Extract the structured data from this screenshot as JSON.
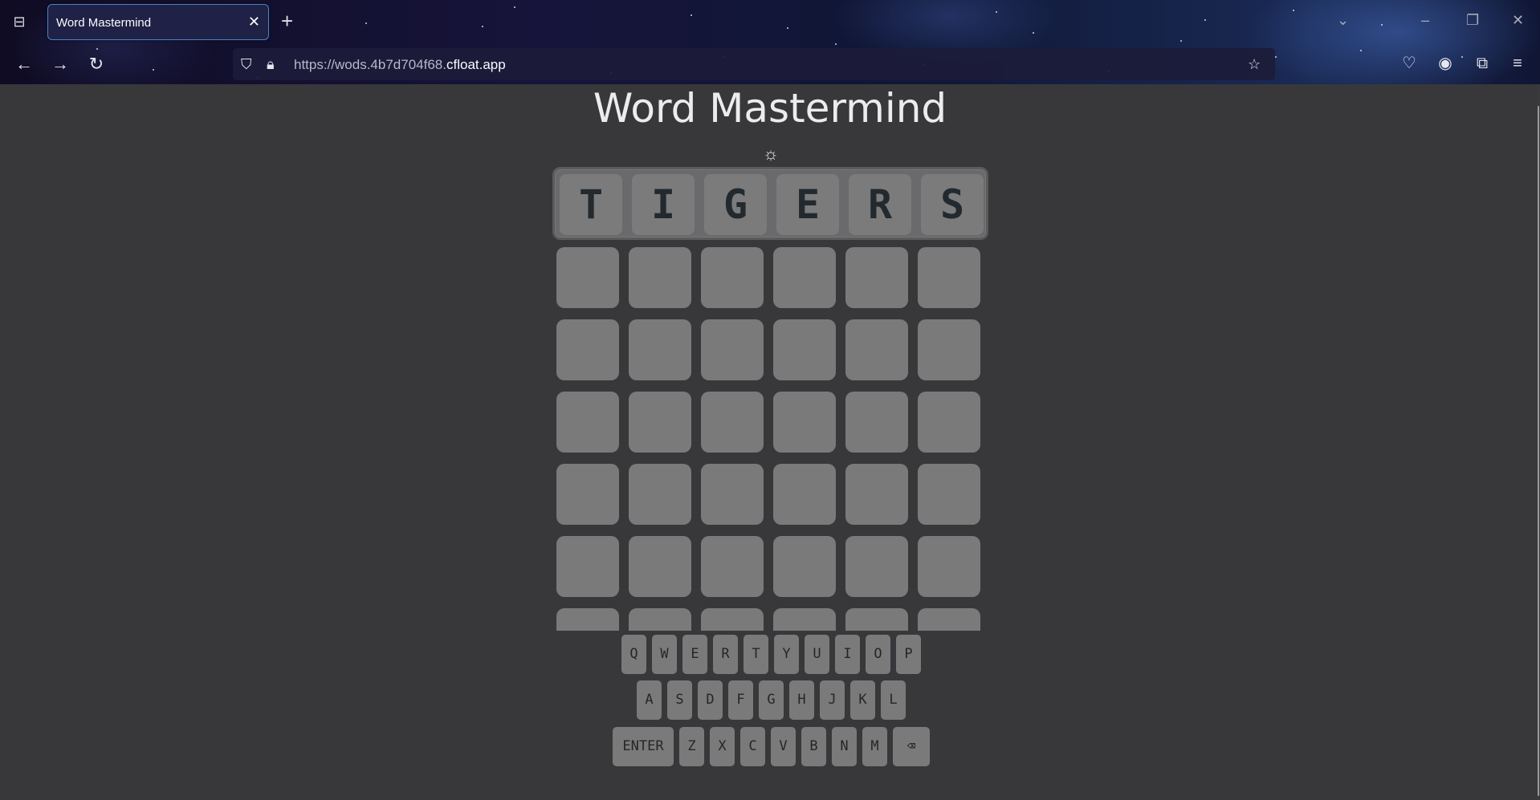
{
  "browser": {
    "tab_title": "Word Mastermind",
    "url_prefix": "https://wods.4b7d704f68.",
    "url_domain": "cfloat.app"
  },
  "page": {
    "title": "Word Mastermind",
    "theme_icon": "sun-icon"
  },
  "target_word": [
    "T",
    "I",
    "G",
    "E",
    "R",
    "S"
  ],
  "board": {
    "columns": 6,
    "visible_rows": 6,
    "rows": [
      [
        "",
        "",
        "",
        "",
        "",
        ""
      ],
      [
        "",
        "",
        "",
        "",
        "",
        ""
      ],
      [
        "",
        "",
        "",
        "",
        "",
        ""
      ],
      [
        "",
        "",
        "",
        "",
        "",
        ""
      ],
      [
        "",
        "",
        "",
        "",
        "",
        ""
      ],
      [
        "",
        "",
        "",
        "",
        "",
        ""
      ]
    ]
  },
  "keyboard": {
    "row1": [
      "Q",
      "W",
      "E",
      "R",
      "T",
      "Y",
      "U",
      "I",
      "O",
      "P"
    ],
    "row2": [
      "A",
      "S",
      "D",
      "F",
      "G",
      "H",
      "J",
      "K",
      "L"
    ],
    "row3": [
      "ENTER",
      "Z",
      "X",
      "C",
      "V",
      "B",
      "N",
      "M",
      "⌫"
    ]
  }
}
